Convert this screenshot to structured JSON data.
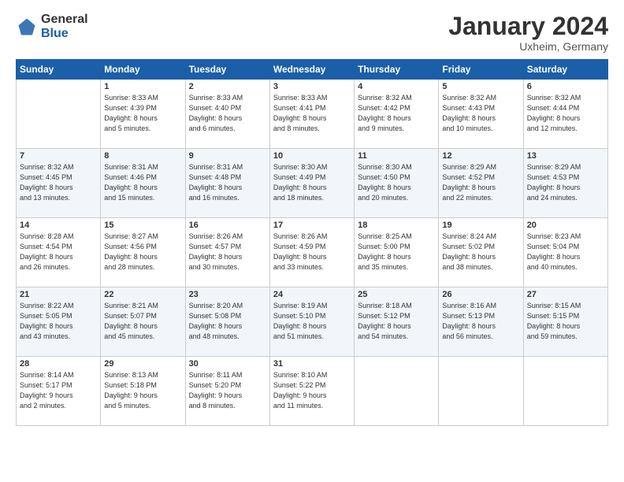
{
  "logo": {
    "general": "General",
    "blue": "Blue"
  },
  "title": "January 2024",
  "location": "Uxheim, Germany",
  "days_header": [
    "Sunday",
    "Monday",
    "Tuesday",
    "Wednesday",
    "Thursday",
    "Friday",
    "Saturday"
  ],
  "weeks": [
    [
      {
        "num": "",
        "info": ""
      },
      {
        "num": "1",
        "info": "Sunrise: 8:33 AM\nSunset: 4:39 PM\nDaylight: 8 hours\nand 5 minutes."
      },
      {
        "num": "2",
        "info": "Sunrise: 8:33 AM\nSunset: 4:40 PM\nDaylight: 8 hours\nand 6 minutes."
      },
      {
        "num": "3",
        "info": "Sunrise: 8:33 AM\nSunset: 4:41 PM\nDaylight: 8 hours\nand 8 minutes."
      },
      {
        "num": "4",
        "info": "Sunrise: 8:32 AM\nSunset: 4:42 PM\nDaylight: 8 hours\nand 9 minutes."
      },
      {
        "num": "5",
        "info": "Sunrise: 8:32 AM\nSunset: 4:43 PM\nDaylight: 8 hours\nand 10 minutes."
      },
      {
        "num": "6",
        "info": "Sunrise: 8:32 AM\nSunset: 4:44 PM\nDaylight: 8 hours\nand 12 minutes."
      }
    ],
    [
      {
        "num": "7",
        "info": "Sunrise: 8:32 AM\nSunset: 4:45 PM\nDaylight: 8 hours\nand 13 minutes."
      },
      {
        "num": "8",
        "info": "Sunrise: 8:31 AM\nSunset: 4:46 PM\nDaylight: 8 hours\nand 15 minutes."
      },
      {
        "num": "9",
        "info": "Sunrise: 8:31 AM\nSunset: 4:48 PM\nDaylight: 8 hours\nand 16 minutes."
      },
      {
        "num": "10",
        "info": "Sunrise: 8:30 AM\nSunset: 4:49 PM\nDaylight: 8 hours\nand 18 minutes."
      },
      {
        "num": "11",
        "info": "Sunrise: 8:30 AM\nSunset: 4:50 PM\nDaylight: 8 hours\nand 20 minutes."
      },
      {
        "num": "12",
        "info": "Sunrise: 8:29 AM\nSunset: 4:52 PM\nDaylight: 8 hours\nand 22 minutes."
      },
      {
        "num": "13",
        "info": "Sunrise: 8:29 AM\nSunset: 4:53 PM\nDaylight: 8 hours\nand 24 minutes."
      }
    ],
    [
      {
        "num": "14",
        "info": "Sunrise: 8:28 AM\nSunset: 4:54 PM\nDaylight: 8 hours\nand 26 minutes."
      },
      {
        "num": "15",
        "info": "Sunrise: 8:27 AM\nSunset: 4:56 PM\nDaylight: 8 hours\nand 28 minutes."
      },
      {
        "num": "16",
        "info": "Sunrise: 8:26 AM\nSunset: 4:57 PM\nDaylight: 8 hours\nand 30 minutes."
      },
      {
        "num": "17",
        "info": "Sunrise: 8:26 AM\nSunset: 4:59 PM\nDaylight: 8 hours\nand 33 minutes."
      },
      {
        "num": "18",
        "info": "Sunrise: 8:25 AM\nSunset: 5:00 PM\nDaylight: 8 hours\nand 35 minutes."
      },
      {
        "num": "19",
        "info": "Sunrise: 8:24 AM\nSunset: 5:02 PM\nDaylight: 8 hours\nand 38 minutes."
      },
      {
        "num": "20",
        "info": "Sunrise: 8:23 AM\nSunset: 5:04 PM\nDaylight: 8 hours\nand 40 minutes."
      }
    ],
    [
      {
        "num": "21",
        "info": "Sunrise: 8:22 AM\nSunset: 5:05 PM\nDaylight: 8 hours\nand 43 minutes."
      },
      {
        "num": "22",
        "info": "Sunrise: 8:21 AM\nSunset: 5:07 PM\nDaylight: 8 hours\nand 45 minutes."
      },
      {
        "num": "23",
        "info": "Sunrise: 8:20 AM\nSunset: 5:08 PM\nDaylight: 8 hours\nand 48 minutes."
      },
      {
        "num": "24",
        "info": "Sunrise: 8:19 AM\nSunset: 5:10 PM\nDaylight: 8 hours\nand 51 minutes."
      },
      {
        "num": "25",
        "info": "Sunrise: 8:18 AM\nSunset: 5:12 PM\nDaylight: 8 hours\nand 54 minutes."
      },
      {
        "num": "26",
        "info": "Sunrise: 8:16 AM\nSunset: 5:13 PM\nDaylight: 8 hours\nand 56 minutes."
      },
      {
        "num": "27",
        "info": "Sunrise: 8:15 AM\nSunset: 5:15 PM\nDaylight: 8 hours\nand 59 minutes."
      }
    ],
    [
      {
        "num": "28",
        "info": "Sunrise: 8:14 AM\nSunset: 5:17 PM\nDaylight: 9 hours\nand 2 minutes."
      },
      {
        "num": "29",
        "info": "Sunrise: 8:13 AM\nSunset: 5:18 PM\nDaylight: 9 hours\nand 5 minutes."
      },
      {
        "num": "30",
        "info": "Sunrise: 8:11 AM\nSunset: 5:20 PM\nDaylight: 9 hours\nand 8 minutes."
      },
      {
        "num": "31",
        "info": "Sunrise: 8:10 AM\nSunset: 5:22 PM\nDaylight: 9 hours\nand 11 minutes."
      },
      {
        "num": "",
        "info": ""
      },
      {
        "num": "",
        "info": ""
      },
      {
        "num": "",
        "info": ""
      }
    ]
  ]
}
